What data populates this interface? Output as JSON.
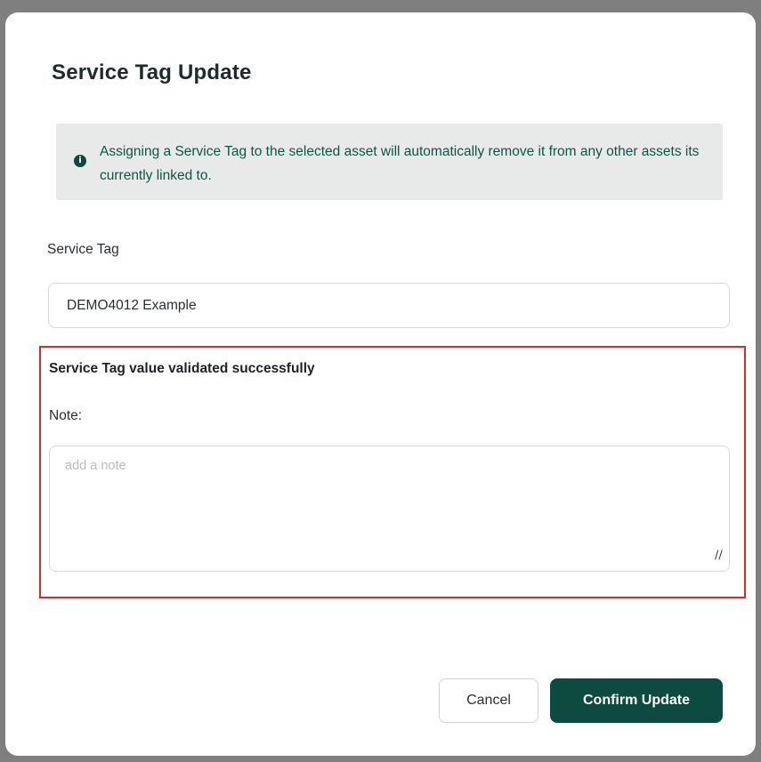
{
  "dialog": {
    "title": "Service Tag Update",
    "info_message": "Assigning a Service Tag to the selected asset will automatically remove it from any other assets its currently linked to.",
    "info_icon": "info-circle-icon",
    "service_tag": {
      "label": "Service Tag",
      "value": "DEMO4012 Example"
    },
    "validation_message": "Service Tag value validated successfully",
    "note": {
      "label": "Note:",
      "placeholder": "add a note",
      "value": ""
    },
    "buttons": {
      "cancel": "Cancel",
      "confirm": "Confirm Update"
    }
  },
  "colors": {
    "primary": "#0d4a40",
    "info_text": "#0f5546",
    "info_bg": "#e8eaea",
    "highlight_border": "#d42b2b",
    "overlay": "#7f7f7f"
  }
}
